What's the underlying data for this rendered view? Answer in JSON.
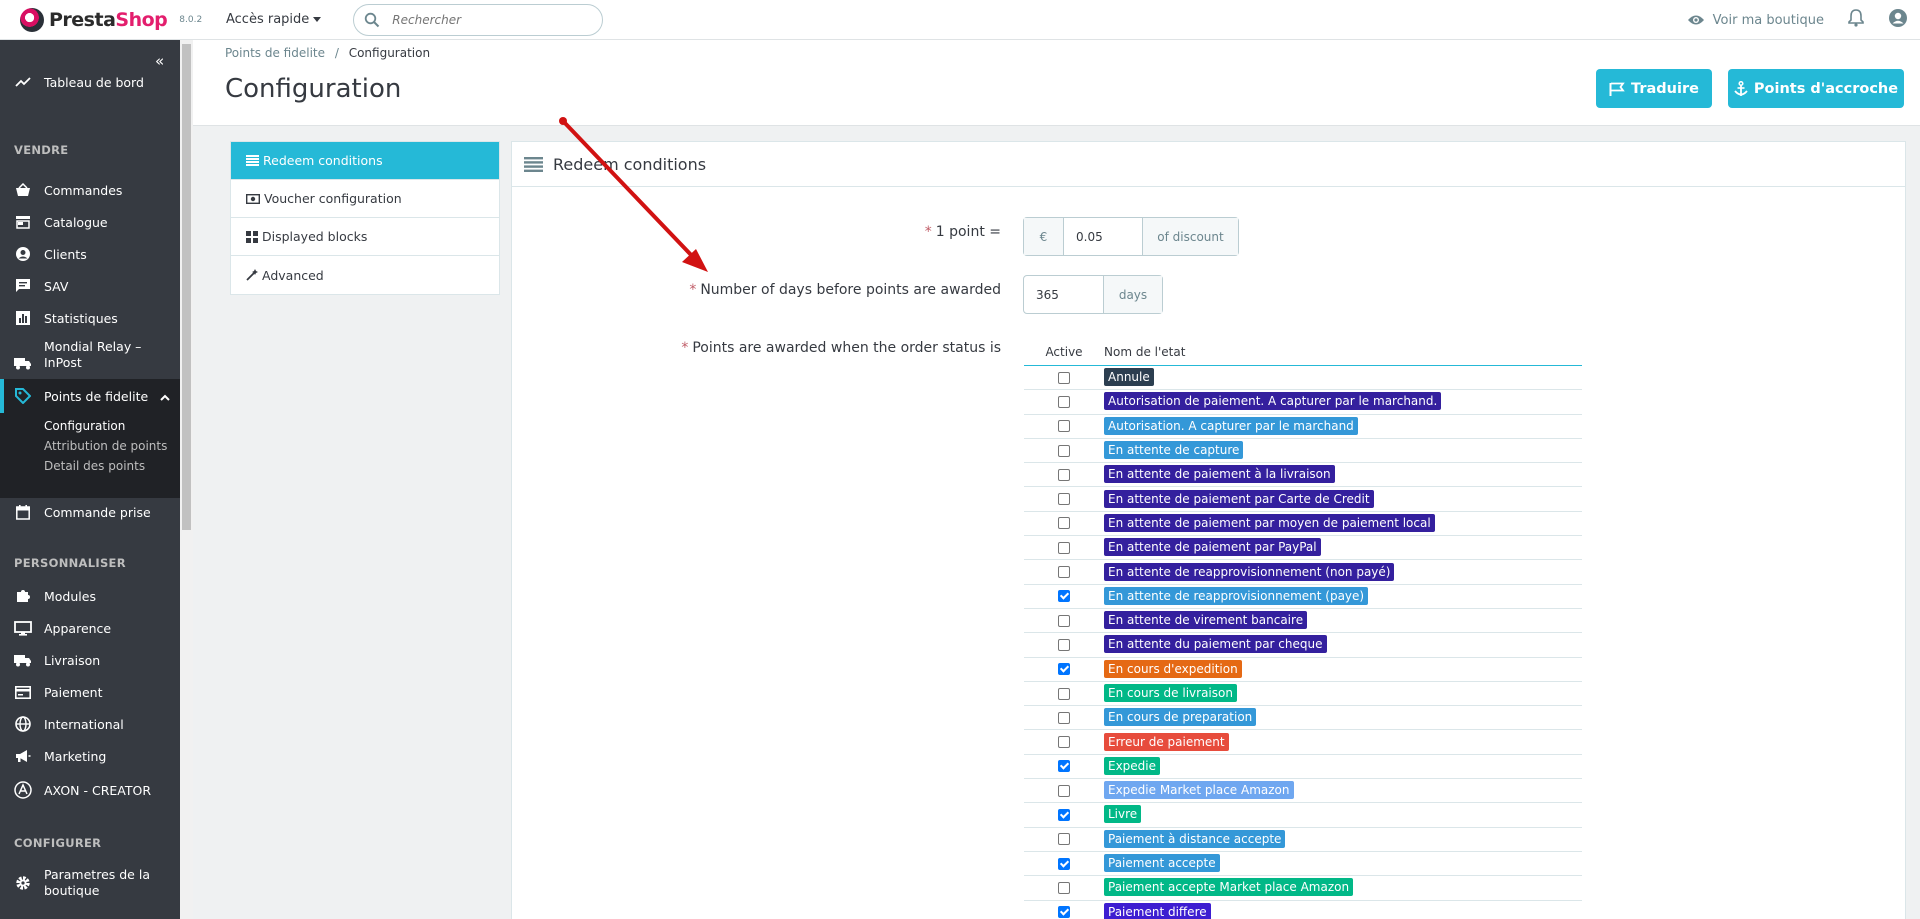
{
  "header": {
    "brand_main": "Presta",
    "brand_second": "Shop",
    "version": "8.0.2",
    "quick_access": "Accès rapide",
    "search_placeholder": "Rechercher",
    "view_shop": "Voir ma boutique"
  },
  "sidebar": {
    "items": [
      {
        "label": "Tableau de bord",
        "icon": "trending-up-icon"
      },
      {
        "label": "Commandes",
        "icon": "basket-icon"
      },
      {
        "label": "Catalogue",
        "icon": "store-icon"
      },
      {
        "label": "Clients",
        "icon": "account-circle-icon"
      },
      {
        "label": "SAV",
        "icon": "chat-icon"
      },
      {
        "label": "Statistiques",
        "icon": "bar-chart-icon"
      },
      {
        "label": "Mondial Relay – InPost",
        "icon": "truck-icon"
      },
      {
        "label": "Points de fidelite",
        "icon": "tag-icon"
      },
      {
        "label": "Commande prise",
        "icon": "calendar-icon"
      },
      {
        "label": "Modules",
        "icon": "puzzle-icon"
      },
      {
        "label": "Apparence",
        "icon": "desktop-icon"
      },
      {
        "label": "Livraison",
        "icon": "truck-icon"
      },
      {
        "label": "Paiement",
        "icon": "credit-card-icon"
      },
      {
        "label": "International",
        "icon": "globe-icon"
      },
      {
        "label": "Marketing",
        "icon": "megaphone-icon"
      },
      {
        "label": "AXON - CREATOR",
        "icon": "axon-icon"
      },
      {
        "label": "Parametres de la boutique",
        "icon": "settings-icon"
      }
    ],
    "sections": [
      "VENDRE",
      "PERSONNALISER",
      "CONFIGURER"
    ],
    "sub_items": [
      "Configuration",
      "Attribution de points",
      "Detail des points"
    ]
  },
  "page": {
    "breadcrumb_parent": "Points de fidelite",
    "breadcrumb_sep": "/",
    "breadcrumb_current": "Configuration",
    "title": "Configuration",
    "translate_button": "Traduire",
    "hooks_button": "Points d'accroche"
  },
  "tabs": [
    {
      "label": "Redeem conditions",
      "icon": "list-icon"
    },
    {
      "label": "Voucher configuration",
      "icon": "money-icon"
    },
    {
      "label": "Displayed blocks",
      "icon": "grid-icon"
    },
    {
      "label": "Advanced",
      "icon": "magic-wand-icon"
    }
  ],
  "panel": {
    "title": "Redeem conditions",
    "point_label": "1 point =",
    "point_currency": "€",
    "point_value": "0.05",
    "point_suffix": "of discount",
    "days_label": "Number of days before points are awarded",
    "days_value": "365",
    "days_suffix": "days",
    "status_label": "Points are awarded when the order status is",
    "required_mark": "*"
  },
  "status_table": {
    "col_active": "Active",
    "col_name": "Nom de l'etat",
    "rows": [
      {
        "name": "Annule",
        "checked": false,
        "color": "#2c3e50"
      },
      {
        "name": "Autorisation de paiement. A capturer par le marchand.",
        "checked": false,
        "color": "#34209e"
      },
      {
        "name": "Autorisation. A capturer par le marchand",
        "checked": false,
        "color": "#3498d8"
      },
      {
        "name": "En attente de capture",
        "checked": false,
        "color": "#3498d8"
      },
      {
        "name": "En attente de paiement à la livraison",
        "checked": false,
        "color": "#34209e"
      },
      {
        "name": "En attente de paiement par Carte de Credit",
        "checked": false,
        "color": "#34209e"
      },
      {
        "name": "En attente de paiement par moyen de paiement local",
        "checked": false,
        "color": "#34209e"
      },
      {
        "name": "En attente de paiement par PayPal",
        "checked": false,
        "color": "#34209e"
      },
      {
        "name": "En attente de reapprovisionnement (non payé)",
        "checked": false,
        "color": "#34209e"
      },
      {
        "name": "En attente de reapprovisionnement (paye)",
        "checked": true,
        "color": "#3498d8"
      },
      {
        "name": "En attente de virement bancaire",
        "checked": false,
        "color": "#34209e"
      },
      {
        "name": "En attente du paiement par cheque",
        "checked": false,
        "color": "#34209e"
      },
      {
        "name": "En cours d'expedition",
        "checked": true,
        "color": "#e56914"
      },
      {
        "name": "En cours de livraison",
        "checked": false,
        "color": "#01b887"
      },
      {
        "name": "En cours de preparation",
        "checked": false,
        "color": "#3498d8"
      },
      {
        "name": "Erreur de paiement",
        "checked": false,
        "color": "#e74c3c"
      },
      {
        "name": "Expedie",
        "checked": true,
        "color": "#01b887"
      },
      {
        "name": "Expedie Market place Amazon",
        "checked": false,
        "color": "#6fa7f0"
      },
      {
        "name": "Livre",
        "checked": true,
        "color": "#01b887"
      },
      {
        "name": "Paiement à distance accepte",
        "checked": false,
        "color": "#3498d8"
      },
      {
        "name": "Paiement accepte",
        "checked": true,
        "color": "#3498d8"
      },
      {
        "name": "Paiement accepte Market place Amazon",
        "checked": false,
        "color": "#01b887"
      },
      {
        "name": "Paiement differe",
        "checked": true,
        "color": "#3d1ed1"
      }
    ]
  },
  "colors": {
    "accent": "#25b9d7",
    "sidebar_bg": "#363a41",
    "annotation_arrow": "#d11212"
  }
}
